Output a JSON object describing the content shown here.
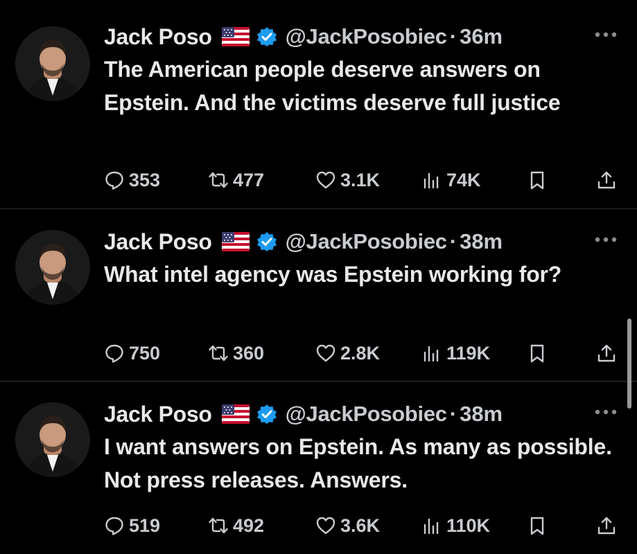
{
  "tweets": [
    {
      "author_name": "Jack Poso",
      "flag_icon": "us-flag-icon",
      "verified_icon": "verified-badge-icon",
      "handle": "@JackPosobiec",
      "separator": "·",
      "time": "36m",
      "text": "The American people deserve answers on Epstein. And the victims deserve full justice",
      "stats": {
        "replies": "353",
        "retweets": "477",
        "likes": "3.1K",
        "views": "74K"
      }
    },
    {
      "author_name": "Jack Poso",
      "flag_icon": "us-flag-icon",
      "verified_icon": "verified-badge-icon",
      "handle": "@JackPosobiec",
      "separator": "·",
      "time": "38m",
      "text": "What intel agency was Epstein working for?",
      "stats": {
        "replies": "750",
        "retweets": "360",
        "likes": "2.8K",
        "views": "119K"
      }
    },
    {
      "author_name": "Jack Poso",
      "flag_icon": "us-flag-icon",
      "verified_icon": "verified-badge-icon",
      "handle": "@JackPosobiec",
      "separator": "·",
      "time": "38m",
      "text": "I want answers on Epstein. As many as possible. Not press releases. Answers.",
      "stats": {
        "replies": "519",
        "retweets": "492",
        "likes": "3.6K",
        "views": "110K"
      }
    }
  ],
  "colors": {
    "background": "#000000",
    "text_primary": "#e7e9ea",
    "text_secondary": "#c8cbcf",
    "verified_blue": "#1d9bf0",
    "divider": "#2f3336"
  }
}
